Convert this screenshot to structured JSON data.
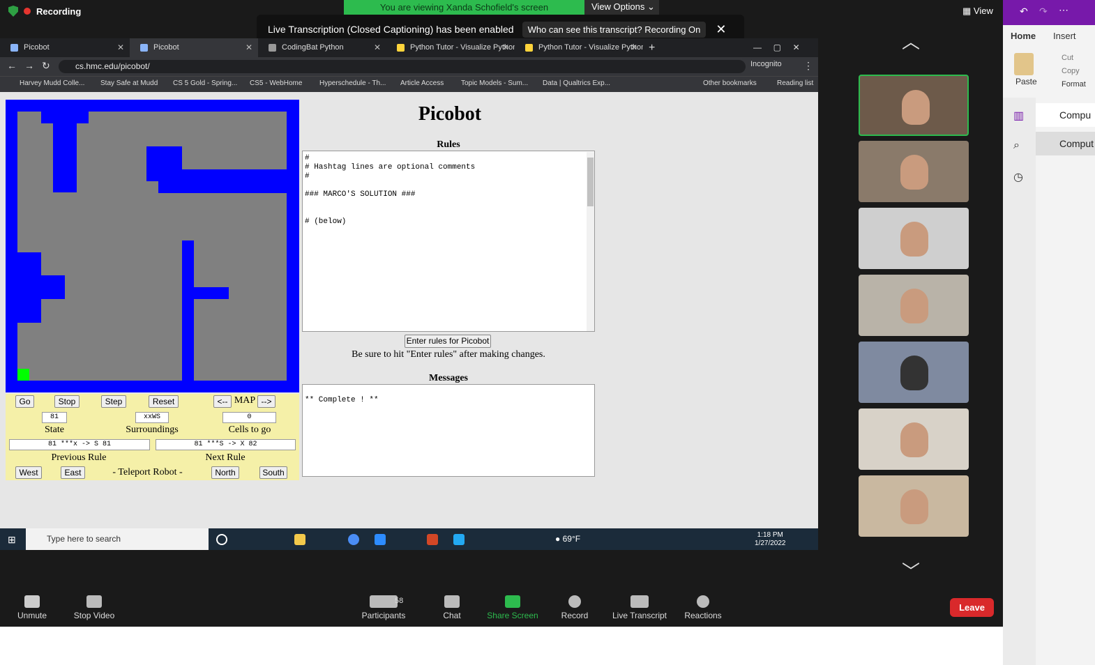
{
  "zoom_top": {
    "recording": "Recording",
    "viewing": "You are viewing Xanda Schofield's screen",
    "view_options": "View Options",
    "view": "View"
  },
  "banner": {
    "text": "Live Transcription (Closed Captioning) has been enabled",
    "who": "Who can see this transcript? Recording On"
  },
  "tabs": [
    "Picobot",
    "Picobot",
    "CodingBat Python",
    "Python Tutor - Visualize Python,",
    "Python Tutor - Visualize Python,"
  ],
  "url": "cs.hmc.edu/picobot/",
  "incognito": "Incognito",
  "bookmarks": [
    "Harvey Mudd Colle...",
    "Stay Safe at Mudd",
    "CS 5 Gold - Spring...",
    "CS5 - WebHome",
    "Hyperschedule - Th...",
    "Article Access",
    "Topic Models - Sum...",
    "Data | Qualtrics Exp...",
    "Other bookmarks",
    "Reading list"
  ],
  "picobot": {
    "title": "Picobot",
    "rules_heading": "Rules",
    "rules_text": "#\n# Hashtag lines are optional comments\n#\n\n### MARCO'S SOLUTION ###\n\n\n# (below)",
    "enter_button": "Enter rules for Picobot",
    "note": "Be sure to hit \"Enter rules\" after making changes.",
    "messages_heading": "Messages",
    "messages_text": "** Complete ! **",
    "controls": {
      "go": "Go",
      "stop": "Stop",
      "step": "Step",
      "reset": "Reset",
      "prev_map": "<--",
      "map": "MAP",
      "next_map": "-->",
      "state_value": "81",
      "surroundings_value": "xxWS",
      "cells_value": "0",
      "state_label": "State",
      "surroundings_label": "Surroundings",
      "cells_label": "Cells to go",
      "prev_rule": "81 ***x -> S 81",
      "next_rule": "81 ***S -> X 82",
      "prev_rule_label": "Previous Rule",
      "next_rule_label": "Next Rule",
      "west": "West",
      "east": "East",
      "teleport": "- Teleport Robot -",
      "north": "North",
      "south": "South"
    },
    "colors": {
      "wall": "#0000ff",
      "floor": "#808080",
      "robot": "#00ff00"
    }
  },
  "taskbar": {
    "search_placeholder": "Type here to search",
    "weather": "69°F",
    "time": "1:18 PM",
    "date": "1/27/2022"
  },
  "zoom_bar": {
    "unmute": "Unmute",
    "stop_video": "Stop Video",
    "participants": "Participants",
    "participant_count": "58",
    "chat": "Chat",
    "share": "Share Screen",
    "record": "Record",
    "transcript": "Live Transcript",
    "reactions": "Reactions",
    "leave": "Leave"
  },
  "onenote": {
    "home": "Home",
    "insert": "Insert",
    "paste": "Paste",
    "cut": "Cut",
    "copy": "Copy",
    "format": "Format",
    "item1": "Compu",
    "item2": "Comput"
  }
}
